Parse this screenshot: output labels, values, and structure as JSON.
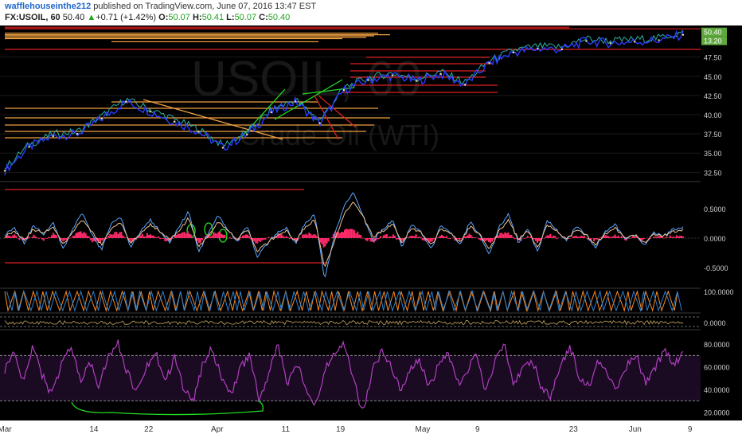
{
  "header": {
    "username": "wafflehouseinthe212",
    "published": " published on TradingView.com, June 07, 2016 13:47 EST",
    "symbol": "FX:USOIL, 60",
    "last": "50.40",
    "change_arrow": "▲",
    "change": "+0.71 (+1.42%)",
    "o_label": "O:",
    "o": "50.07",
    "h_label": "H:",
    "h": "50.41",
    "l_label": "L:",
    "l": "50.07",
    "c_label": "C:",
    "c": "50.40"
  },
  "watermark": {
    "symbol": "USOIL, 60",
    "name": "Crude Oil (WTI)"
  },
  "colors": {
    "background": "#000000",
    "price_line_a": "#2a3cff",
    "price_line_b": "#2bb3a0",
    "red_line": "#e02020",
    "orange_line": "#f0a040",
    "green_line": "#22dd22",
    "macd_fast": "#5aa5ff",
    "macd_slow": "#f0c090",
    "histogram": "#ff2a6a",
    "stoch_k": "#ff8a20",
    "stoch_d": "#2a80d0",
    "rsi": "#b040c0",
    "price_badge": "#5fa83e"
  },
  "chart_data": [
    {
      "panel": "price",
      "type": "line",
      "series": [
        {
          "name": "",
          "x": [
            "Mar 1",
            "Mar 7",
            "Mar 10",
            "Mar 14",
            "Mar 17",
            "Mar 22",
            "Mar 25",
            "Mar 29",
            "Apr 1",
            "Apr 5",
            "Apr 8",
            "Apr 11",
            "Apr 14",
            "Apr 18",
            "Apr 21",
            "Apr 25",
            "Apr 28",
            "May 2",
            "May 5",
            "May 9",
            "May 12",
            "May 16",
            "May 19",
            "May 23",
            "May 26",
            "May 30",
            "Jun 2",
            "Jun 6",
            "Jun 7"
          ],
          "values": [
            32.7,
            35.8,
            37.2,
            37.5,
            39.5,
            41.7,
            40.4,
            39.1,
            37.8,
            35.7,
            37.4,
            40.3,
            41.7,
            38.9,
            43.2,
            44.5,
            45.1,
            44.4,
            45.3,
            43.9,
            46.7,
            48.1,
            48.6,
            48.5,
            49.6,
            49.3,
            49.5,
            49.7,
            50.4
          ]
        }
      ],
      "y_ticks": [
        "32.50",
        "35.00",
        "37.50",
        "40.00",
        "42.50",
        "45.00",
        "47.50"
      ],
      "ylim": [
        31.5,
        51.3
      ],
      "badges": [
        "50.40",
        "13.20"
      ]
    },
    {
      "panel": "macd",
      "type": "line",
      "series": [
        {
          "name": "",
          "values": [
            0.06,
            0.18,
            -0.08,
            0.22,
            0.05,
            0.28,
            -0.18,
            0.15,
            0.42,
            0.05,
            -0.2,
            0.25,
            0.35,
            -0.15,
            0.1,
            0.32,
            0.12,
            -0.08,
            0.2,
            0.45,
            -0.25,
            0.1,
            0.38,
            0.15,
            -0.05,
            0.22,
            -0.32,
            -0.12,
            0.08,
            0.18,
            -0.1,
            0.25,
            0.4,
            -0.7,
            0.05,
            0.52,
            0.78,
            0.35,
            -0.05,
            0.15,
            0.3,
            -0.15,
            0.25,
            0.08,
            -0.2,
            0.22,
            0.1,
            -0.12,
            0.28,
            0.05,
            -0.28,
            0.18,
            0.4,
            -0.08,
            0.15,
            -0.22,
            0.3,
            0.12,
            -0.05,
            0.2,
            0.05,
            -0.15,
            0.12,
            0.22,
            0.0,
            0.06,
            -0.12,
            0.1,
            0.03,
            0.15,
            0.18
          ]
        },
        {
          "name": "",
          "values": [
            0.03,
            0.12,
            -0.02,
            0.15,
            0.08,
            0.2,
            -0.1,
            0.1,
            0.3,
            0.1,
            -0.12,
            0.16,
            0.26,
            -0.08,
            0.06,
            0.24,
            0.12,
            -0.03,
            0.13,
            0.34,
            -0.16,
            0.05,
            0.27,
            0.14,
            -0.02,
            0.16,
            -0.22,
            -0.1,
            0.04,
            0.13,
            -0.06,
            0.18,
            0.31,
            -0.5,
            -0.05,
            0.38,
            0.62,
            0.35,
            0.02,
            0.12,
            0.24,
            -0.08,
            0.18,
            0.08,
            -0.13,
            0.16,
            0.09,
            -0.08,
            0.2,
            0.06,
            -0.19,
            0.12,
            0.3,
            -0.02,
            0.11,
            -0.15,
            0.22,
            0.11,
            -0.02,
            0.14,
            0.05,
            -0.1,
            0.08,
            0.16,
            0.02,
            0.05,
            -0.08,
            0.07,
            0.03,
            0.11,
            0.14
          ]
        }
      ],
      "y_ticks": [
        "0.5000",
        "0.0000",
        "-0.5000"
      ],
      "ylim": [
        -0.82,
        0.9
      ]
    },
    {
      "panel": "stochastic",
      "type": "line",
      "y_ticks": [
        "100.0000"
      ],
      "ylim": [
        0,
        100
      ]
    },
    {
      "panel": "oscillator",
      "type": "line",
      "y_ticks": [
        "0.0000"
      ]
    },
    {
      "panel": "rsi",
      "type": "line",
      "series": [
        {
          "name": "",
          "values": [
            58,
            72,
            45,
            80,
            52,
            35,
            62,
            78,
            48,
            66,
            42,
            70,
            82,
            55,
            38,
            60,
            75,
            45,
            68,
            40,
            30,
            62,
            76,
            50,
            36,
            58,
            72,
            28,
            55,
            80,
            45,
            64,
            38,
            25,
            58,
            70,
            82,
            48,
            20,
            56,
            74,
            62,
            40,
            58,
            68,
            42,
            60,
            74,
            44,
            56,
            70,
            38,
            64,
            80,
            46,
            58,
            66,
            40,
            34,
            62,
            78,
            50,
            42,
            66,
            55,
            38,
            60,
            72,
            46,
            58,
            74,
            62,
            72
          ]
        }
      ],
      "y_ticks": [
        "80.0000",
        "60.0000",
        "40.0000",
        "20.0000"
      ],
      "ylim": [
        14,
        90
      ]
    }
  ],
  "x_axis_ticks": [
    {
      "label": "Mar",
      "day": 0
    },
    {
      "label": "14",
      "day": 13
    },
    {
      "label": "22",
      "day": 21
    },
    {
      "label": "Apr",
      "day": 31
    },
    {
      "label": "11",
      "day": 41
    },
    {
      "label": "19",
      "day": 49
    },
    {
      "label": "May",
      "day": 61
    },
    {
      "label": "9",
      "day": 69
    },
    {
      "label": "23",
      "day": 83
    },
    {
      "label": "Jun",
      "day": 92
    },
    {
      "label": "9",
      "day": 100
    }
  ]
}
